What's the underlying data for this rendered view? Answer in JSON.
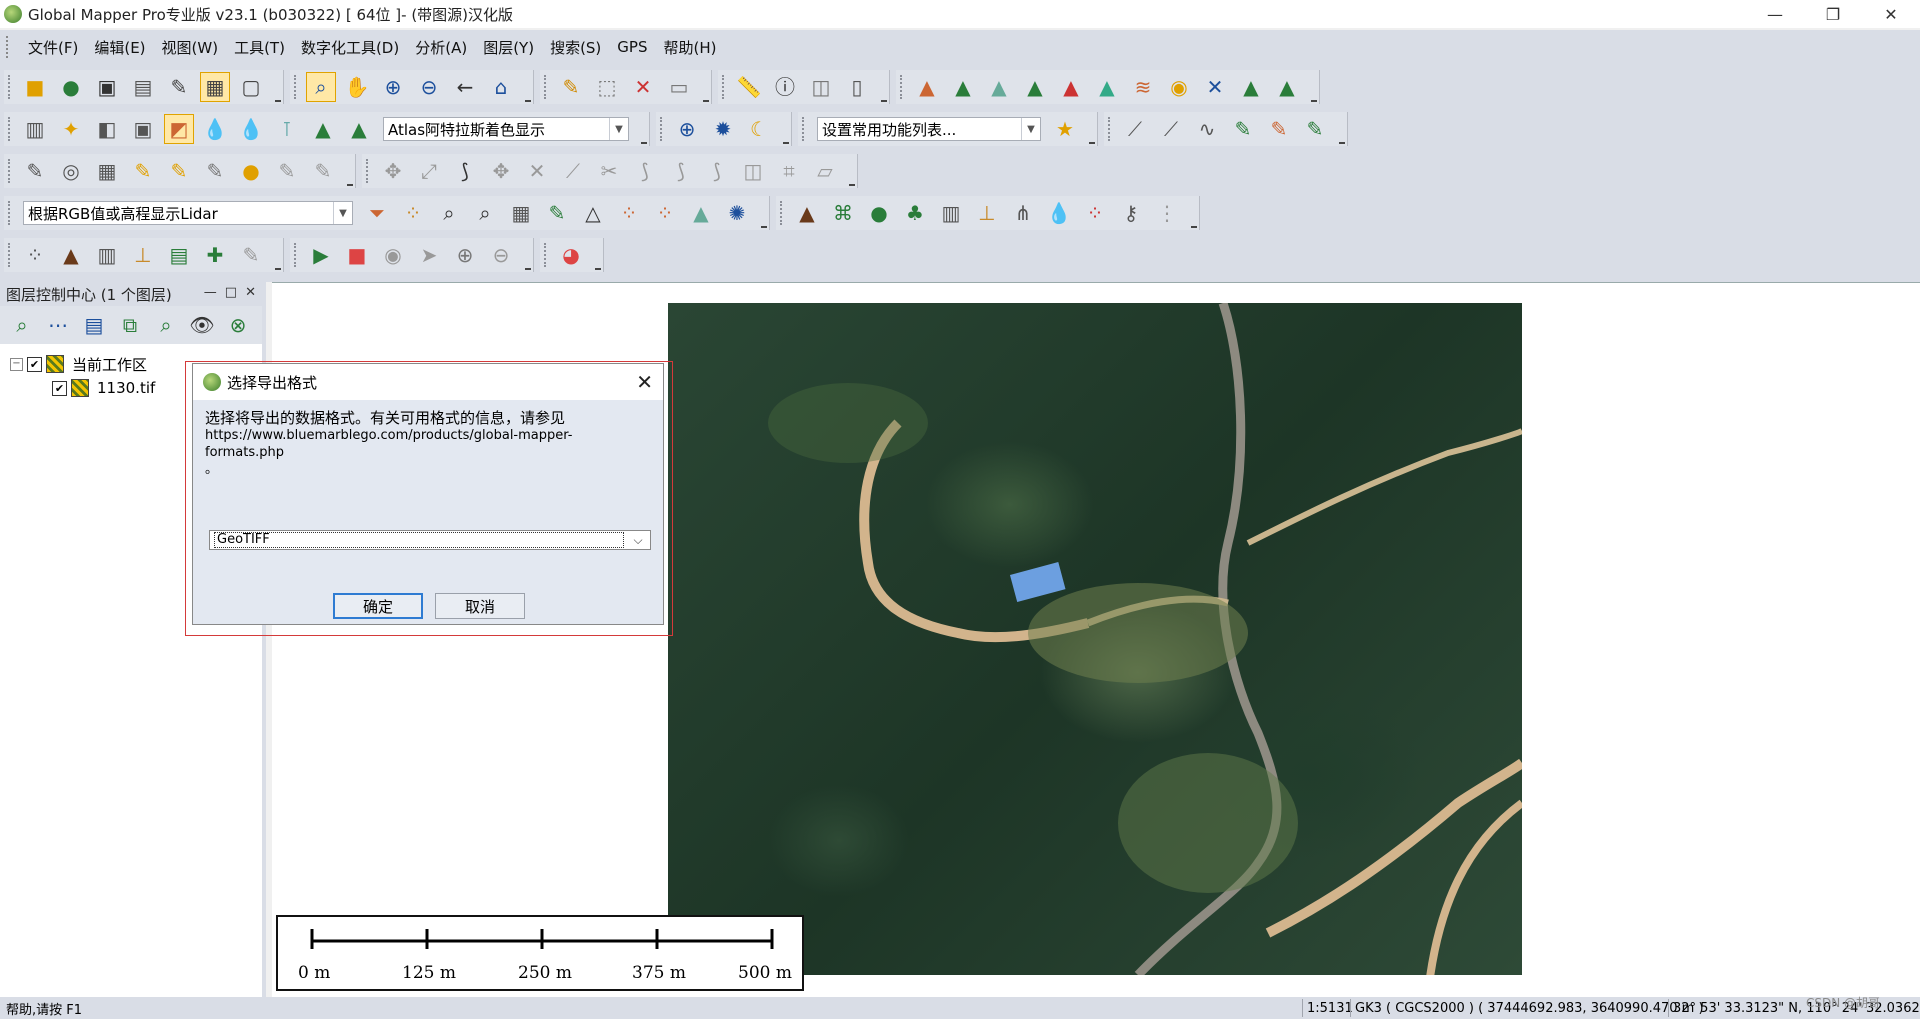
{
  "window": {
    "title": "Global Mapper Pro专业版 v23.1 (b030322) [ 64位 ]-   (带图源)汉化版"
  },
  "menu": [
    "文件(F)",
    "编辑(E)",
    "视图(W)",
    "工具(T)",
    "数字化工具(D)",
    "分析(A)",
    "图层(Y)",
    "搜索(S)",
    "GPS",
    "帮助(H)"
  ],
  "toolbar": {
    "shader_combo": "Atlas阿特拉斯着色显示",
    "feature_combo": "设置常用功能列表...",
    "lidar_combo": "根据RGB值或高程显示Lidar"
  },
  "layer_panel": {
    "title": "图层控制中心 (1 个图层)",
    "workspace_label": "当前工作区",
    "layer_name": "1130.tif"
  },
  "dialog": {
    "title": "选择导出格式",
    "message": "选择将导出的数据格式。有关可用格式的信息，请参见",
    "url": "https://www.bluemarblego.com/products/global-mapper-formats.php",
    "suffix": "。",
    "selected_format": "GeoTIFF",
    "ok_label": "确定",
    "cancel_label": "取消"
  },
  "scalebar": {
    "labels": [
      "0 m",
      "125 m",
      "250 m",
      "375 m",
      "500 m"
    ]
  },
  "status": {
    "help": "帮助,请按 F1",
    "scale": "1:5131",
    "projection": "GK3 ( CGCS2000 ) ( 37444692.983, 3640990.470 m )",
    "latlon": "32° 53' 33.3123\" N, 110° 24' 32.0362\" E"
  },
  "watermark": "CSDN @胡哥"
}
